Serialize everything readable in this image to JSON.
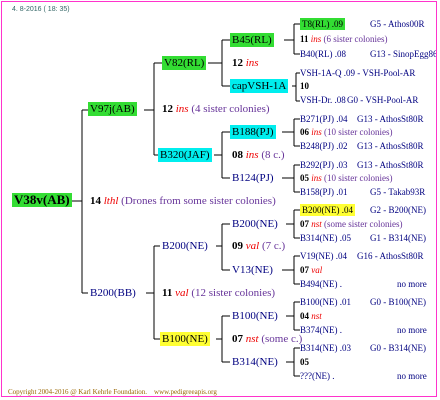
{
  "header": {
    "date": "4. 8-2016 ( 18: 35)"
  },
  "footer": {
    "copyright": "Copyright 2004-2016 @ Karl Kehrle Foundation.",
    "url": "www.pedigreeapis.org"
  },
  "tree": {
    "root": {
      "label": "V38v(AB)",
      "num": "14",
      "ins": "lthl",
      "note": "(Drones from some sister colonies)"
    },
    "g1a": {
      "label": "V97j(AB)",
      "num": "12",
      "ins": "ins",
      "note": "(4 sister colonies)"
    },
    "g1b": {
      "label": "B200(BB)",
      "num": "11",
      "ins": "val",
      "note": "(12 sister colonies)"
    },
    "g2a": {
      "label": "V82(RL)",
      "num": "12",
      "ins": "ins"
    },
    "g2b": {
      "label": "B320(JAF)",
      "num": "08",
      "ins": "ins",
      "note": "(8 c.)"
    },
    "g2c": {
      "label": "B200(NE)",
      "num": "09",
      "ins": "val",
      "note": "(7 c.)"
    },
    "g2d": {
      "label": "B100(NE)",
      "num": "07",
      "ins": "nst",
      "note": "(some c.)"
    },
    "g3a": {
      "label": "B45(RL)"
    },
    "g3b": {
      "label": "capVSH-1A",
      "num": "10"
    },
    "g3c": {
      "label": "B188(PJ)",
      "num": "06",
      "ins": "ins",
      "note": "(10 sister colonies)"
    },
    "g3d": {
      "label": "B124(PJ)",
      "num": "05",
      "ins": "ins",
      "note": "(10 sister colonies)"
    },
    "g3e": {
      "label": "B200(NE)",
      "num": "07",
      "ins": "nst",
      "note": "(some sister colonies)"
    },
    "g3f": {
      "label": "V13(NE)",
      "num": "07",
      "ins": "val"
    },
    "g3g": {
      "label": "B100(NE)",
      "num": "04",
      "ins": "nst"
    },
    "g3h": {
      "label": "B314(NE)",
      "num": "05"
    },
    "g4": [
      {
        "label": "T8(RL) .09",
        "right": "G5 - Athos00R"
      },
      {
        "num": "11",
        "ins": "ins",
        "note": "(6 sister colonies)"
      },
      {
        "label": "B40(RL) .08",
        "right": "G13 - SinopEgg86R"
      },
      {
        "label": "VSH-1A-Q .09 - VSH-Pool-AR"
      },
      {
        "label": "VSH-Dr. .08",
        "right": "G0 - VSH-Pool-AR"
      },
      {
        "label": "B271(PJ) .04",
        "right": "G13 - AthosSt80R"
      },
      {
        "label": "B248(PJ) .02",
        "right": "G13 - AthosSt80R"
      },
      {
        "label": "B292(PJ) .03",
        "right": "G13 - AthosSt80R"
      },
      {
        "label": "B158(PJ) .01",
        "right": "G5 - Takab93R"
      },
      {
        "label": "B200(NE) .04",
        "right": "G2 - B200(NE)"
      },
      {
        "label": "B314(NE) .05",
        "right": "G1 - B314(NE)"
      },
      {
        "label": "V19(NE) .04",
        "right": "G16 - AthosSt80R"
      },
      {
        "label": "B494(NE) .",
        "right": "no more"
      },
      {
        "label": "B100(NE) .01",
        "right": "G0 - B100(NE)"
      },
      {
        "label": "B374(NE) .",
        "right": "no more"
      },
      {
        "label": "B314(NE) .03",
        "right": "G0 - B314(NE)"
      },
      {
        "label": "???(NE) .",
        "right": "no more"
      }
    ]
  }
}
